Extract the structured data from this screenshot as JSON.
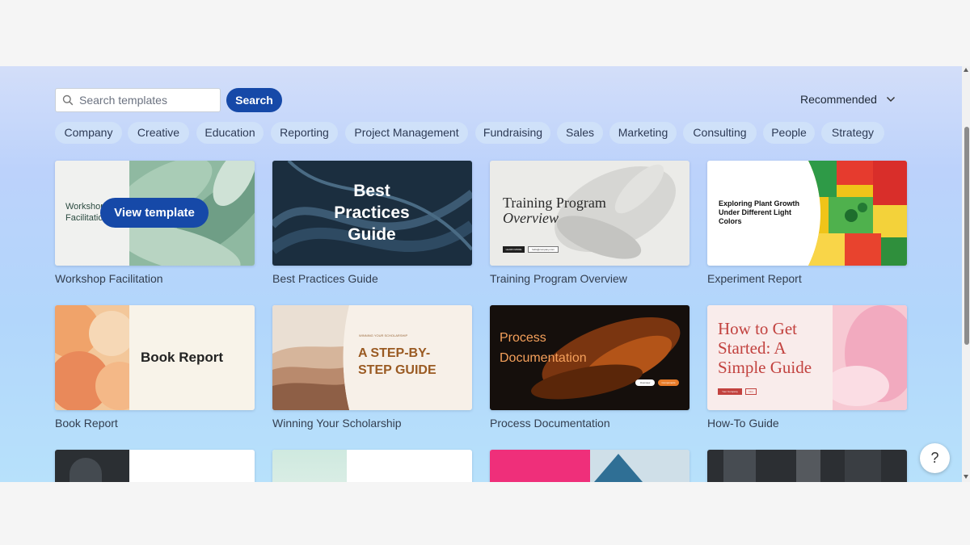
{
  "search": {
    "placeholder": "Search templates",
    "button_label": "Search"
  },
  "sort": {
    "label": "Recommended"
  },
  "categories": [
    "Company",
    "Creative",
    "Education",
    "Reporting",
    "Project Management",
    "Fundraising",
    "Sales",
    "Marketing",
    "Consulting",
    "People",
    "Strategy"
  ],
  "hover_button": "View template",
  "cards": [
    {
      "title": "Workshop Facilitation",
      "thumb_text": "Workshop Facilitation"
    },
    {
      "title": "Best Practices Guide",
      "thumb_text": "Best Practices Guide"
    },
    {
      "title": "Training Program Overview",
      "thumb_text": "Training Program",
      "thumb_sub": "Overview",
      "thumb_pill1": "LEARN MORE",
      "thumb_pill2": "hello@company.com"
    },
    {
      "title": "Experiment Report",
      "thumb_text": "Exploring Plant Growth Under Different Light Colors"
    },
    {
      "title": "Book Report",
      "thumb_text": "Book Report"
    },
    {
      "title": "Winning Your Scholarship",
      "thumb_text": "A STEP-BY-STEP GUIDE",
      "thumb_small": "WINNING YOUR SCHOLARSHIP"
    },
    {
      "title": "Process Documentation",
      "thumb_text": "Process Documentation",
      "thumb_pill1": "Overview",
      "thumb_pill2": "Components"
    },
    {
      "title": "How-To Guide",
      "thumb_text": "How to Get Started: A Simple Guide",
      "thumb_pill1": "Your Company",
      "thumb_pill2": "Intro"
    }
  ],
  "help": {
    "label": "?"
  },
  "colors": {
    "primary": "#1649a8",
    "chip_bg": "#cfe1f9"
  }
}
